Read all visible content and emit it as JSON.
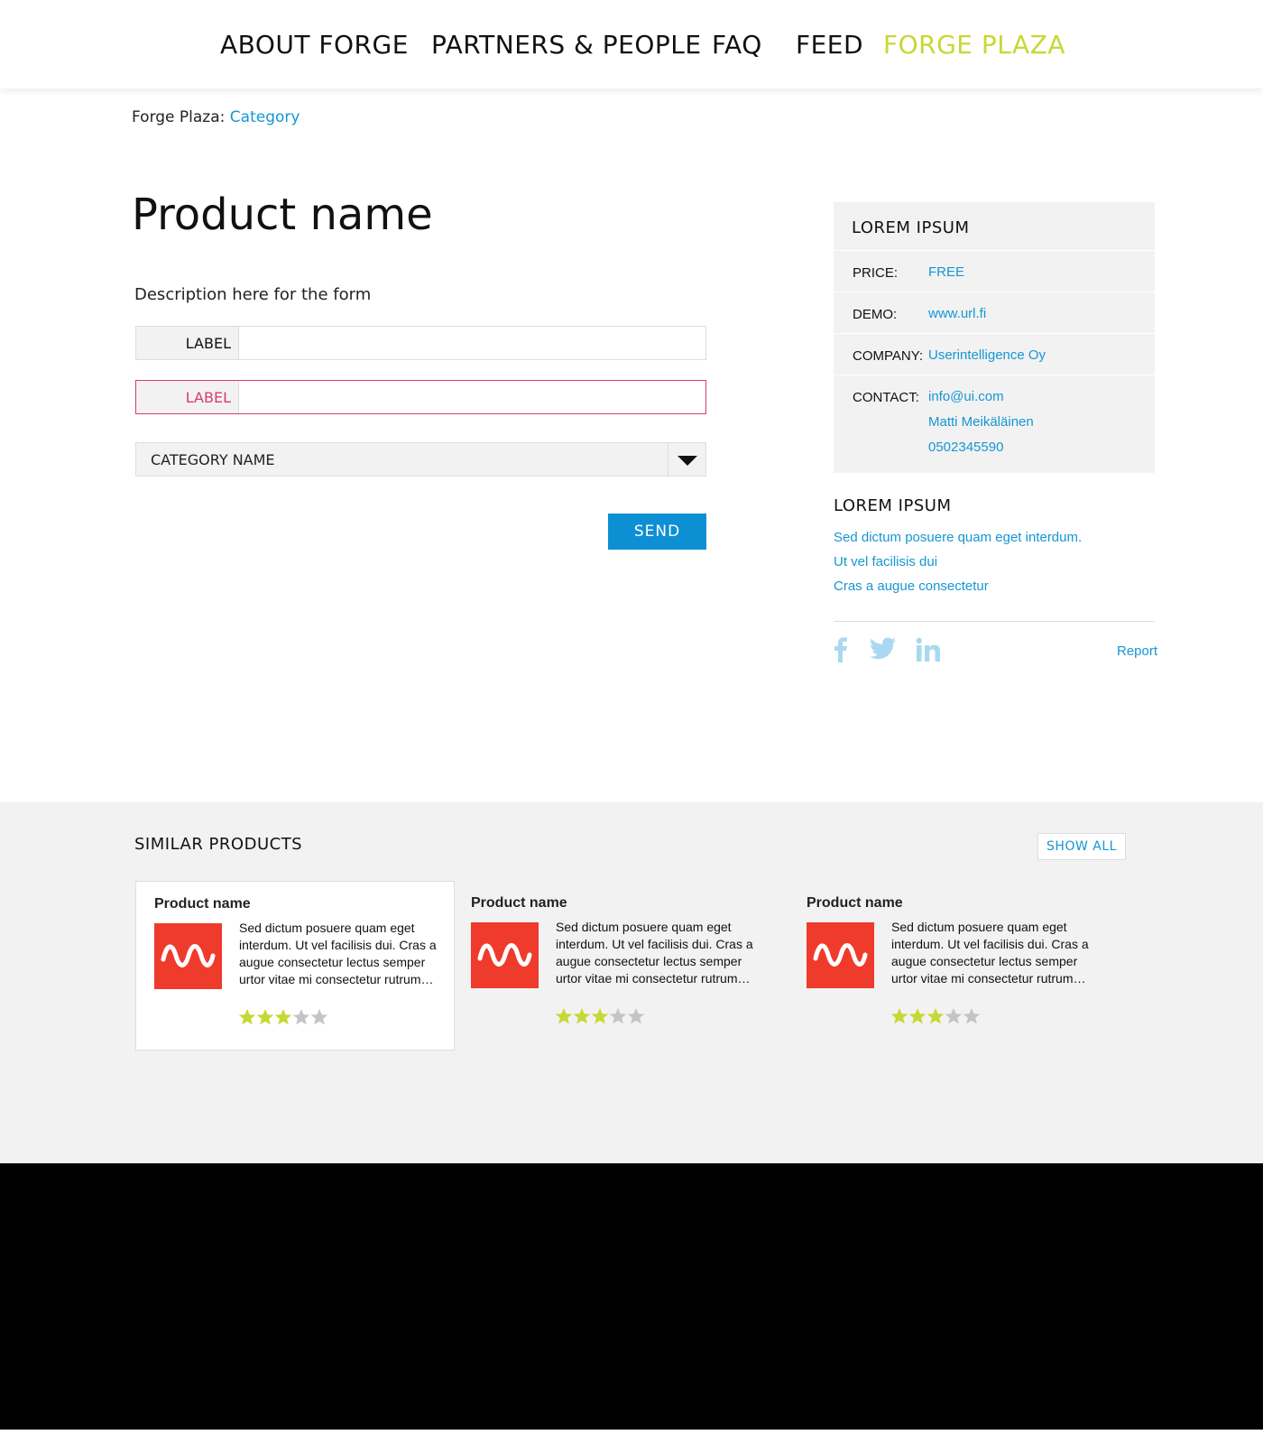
{
  "nav": {
    "items": [
      {
        "label": "ABOUT FORGE"
      },
      {
        "label": "PARTNERS & PEOPLE"
      },
      {
        "label": "FAQ"
      },
      {
        "label": "FEED"
      },
      {
        "label": "FORGE PLAZA",
        "active": true
      }
    ]
  },
  "breadcrumb": {
    "prefix": "Forge Plaza:",
    "link": "Category"
  },
  "page_title": "Product name",
  "form": {
    "description": "Description here for the form",
    "fields": [
      {
        "label": "LABEL",
        "value": "",
        "state": "normal"
      },
      {
        "label": "LABEL",
        "value": "",
        "state": "error"
      }
    ],
    "select": {
      "value": "CATEGORY NAME"
    },
    "send_label": "SEND"
  },
  "infobox": {
    "title": "LOREM IPSUM",
    "rows": [
      {
        "key": "PRICE:",
        "values": [
          "FREE"
        ]
      },
      {
        "key": "DEMO:",
        "values": [
          "www.url.fi"
        ]
      },
      {
        "key": "COMPANY:",
        "values": [
          "Userintelligence Oy"
        ]
      },
      {
        "key": "CONTACT:",
        "values": [
          "info@ui.com",
          "Matti Meikäläinen",
          "0502345590"
        ]
      }
    ]
  },
  "sidebar": {
    "title": "LOREM IPSUM",
    "links": [
      "Sed dictum posuere quam eget interdum.",
      "Ut vel facilisis dui",
      "Cras a augue consectetur"
    ],
    "report_label": "Report",
    "social_icons": [
      "facebook-icon",
      "twitter-icon",
      "linkedin-icon"
    ]
  },
  "similar": {
    "title": "SIMILAR PRODUCTS",
    "show_all_label": "SHOW ALL",
    "products": [
      {
        "name": "Product name",
        "description": "Sed dictum posuere quam eget interdum. Ut vel facilisis dui. Cras a augue consectetur lectus semper urtor vitae mi consectetur rutrum…",
        "rating": 3,
        "rating_max": 5
      },
      {
        "name": "Product name",
        "description": "Sed dictum posuere quam eget interdum. Ut vel facilisis dui. Cras a augue consectetur lectus semper urtor vitae mi consectetur rutrum…",
        "rating": 3,
        "rating_max": 5
      },
      {
        "name": "Product name",
        "description": "Sed dictum posuere quam eget interdum. Ut vel facilisis dui. Cras a augue consectetur lectus semper urtor vitae mi consectetur rutrum…",
        "rating": 3,
        "rating_max": 5
      }
    ]
  },
  "colors": {
    "accent_blue": "#1596d3",
    "nav_active": "#c6d834",
    "error": "#d63a76",
    "thumb_red": "#ef3b2c",
    "star_on": "#c6d834",
    "star_off": "#c4c4c4",
    "social": "#a9d9f0"
  }
}
